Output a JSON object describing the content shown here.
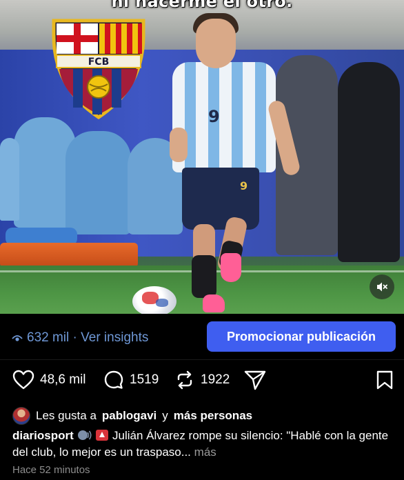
{
  "media": {
    "overlay_caption": "ni hacerme el otro.",
    "crest_text": "FCB",
    "player_shirt_number": "9",
    "player_shorts_number": "9",
    "mute_icon": "speaker-muted-icon"
  },
  "insights": {
    "views_label": "632 mil · Ver insights",
    "promote_label": "Promocionar publicación"
  },
  "actions": {
    "likes": "48,6 mil",
    "comments": "1519",
    "reposts": "1922"
  },
  "liked_by": {
    "prefix": "Les gusta a",
    "user": "pablogavi",
    "connector": "y",
    "others": "más personas"
  },
  "caption": {
    "username": "diariosport",
    "text": "Julián Álvarez rompe su silencio: \"Hablé con la gente del club, lo mejor es un traspaso...",
    "more_label": "más"
  },
  "timestamp": "Hace 52 minutos",
  "colors": {
    "accent_blue": "#3f5ef0",
    "link_blue": "#6f98d6",
    "background": "#000000",
    "secondary_text": "#8e8e8e"
  }
}
